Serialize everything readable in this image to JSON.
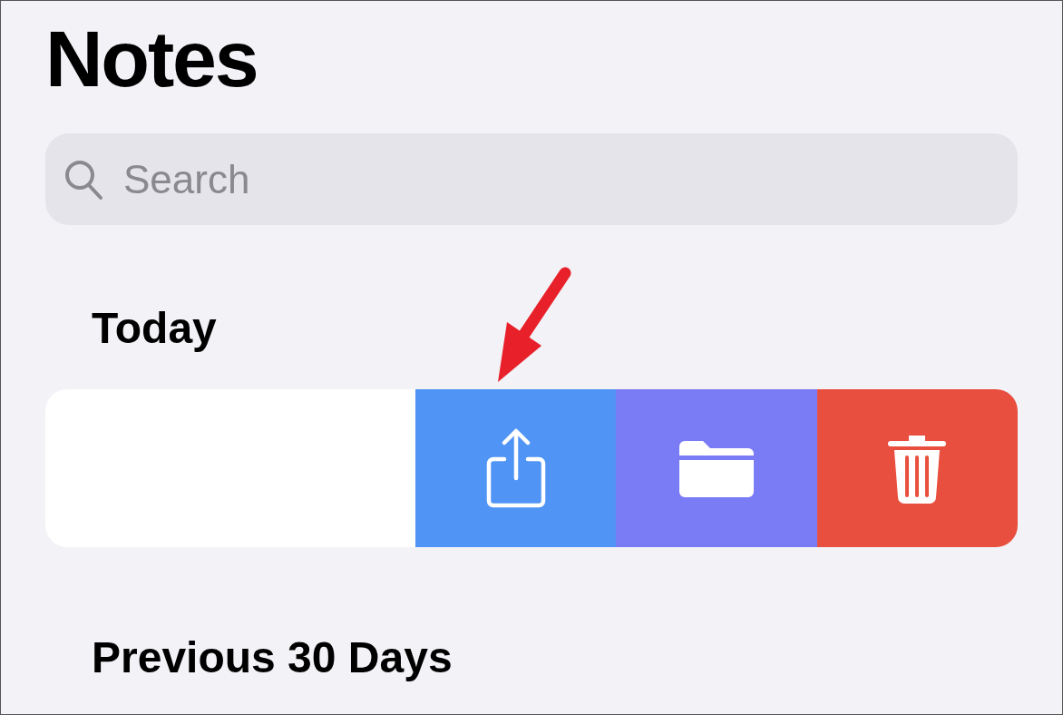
{
  "title": "Notes",
  "search": {
    "placeholder": "Search"
  },
  "sections": [
    {
      "title": "Today",
      "swipe_row": {
        "actions": [
          {
            "kind": "share",
            "color": "#5094f5"
          },
          {
            "kind": "folder",
            "color": "#7a7cf5"
          },
          {
            "kind": "delete",
            "color": "#e94f3e"
          }
        ]
      }
    },
    {
      "title": "Previous 30 Days"
    }
  ],
  "annotation_arrow": true
}
